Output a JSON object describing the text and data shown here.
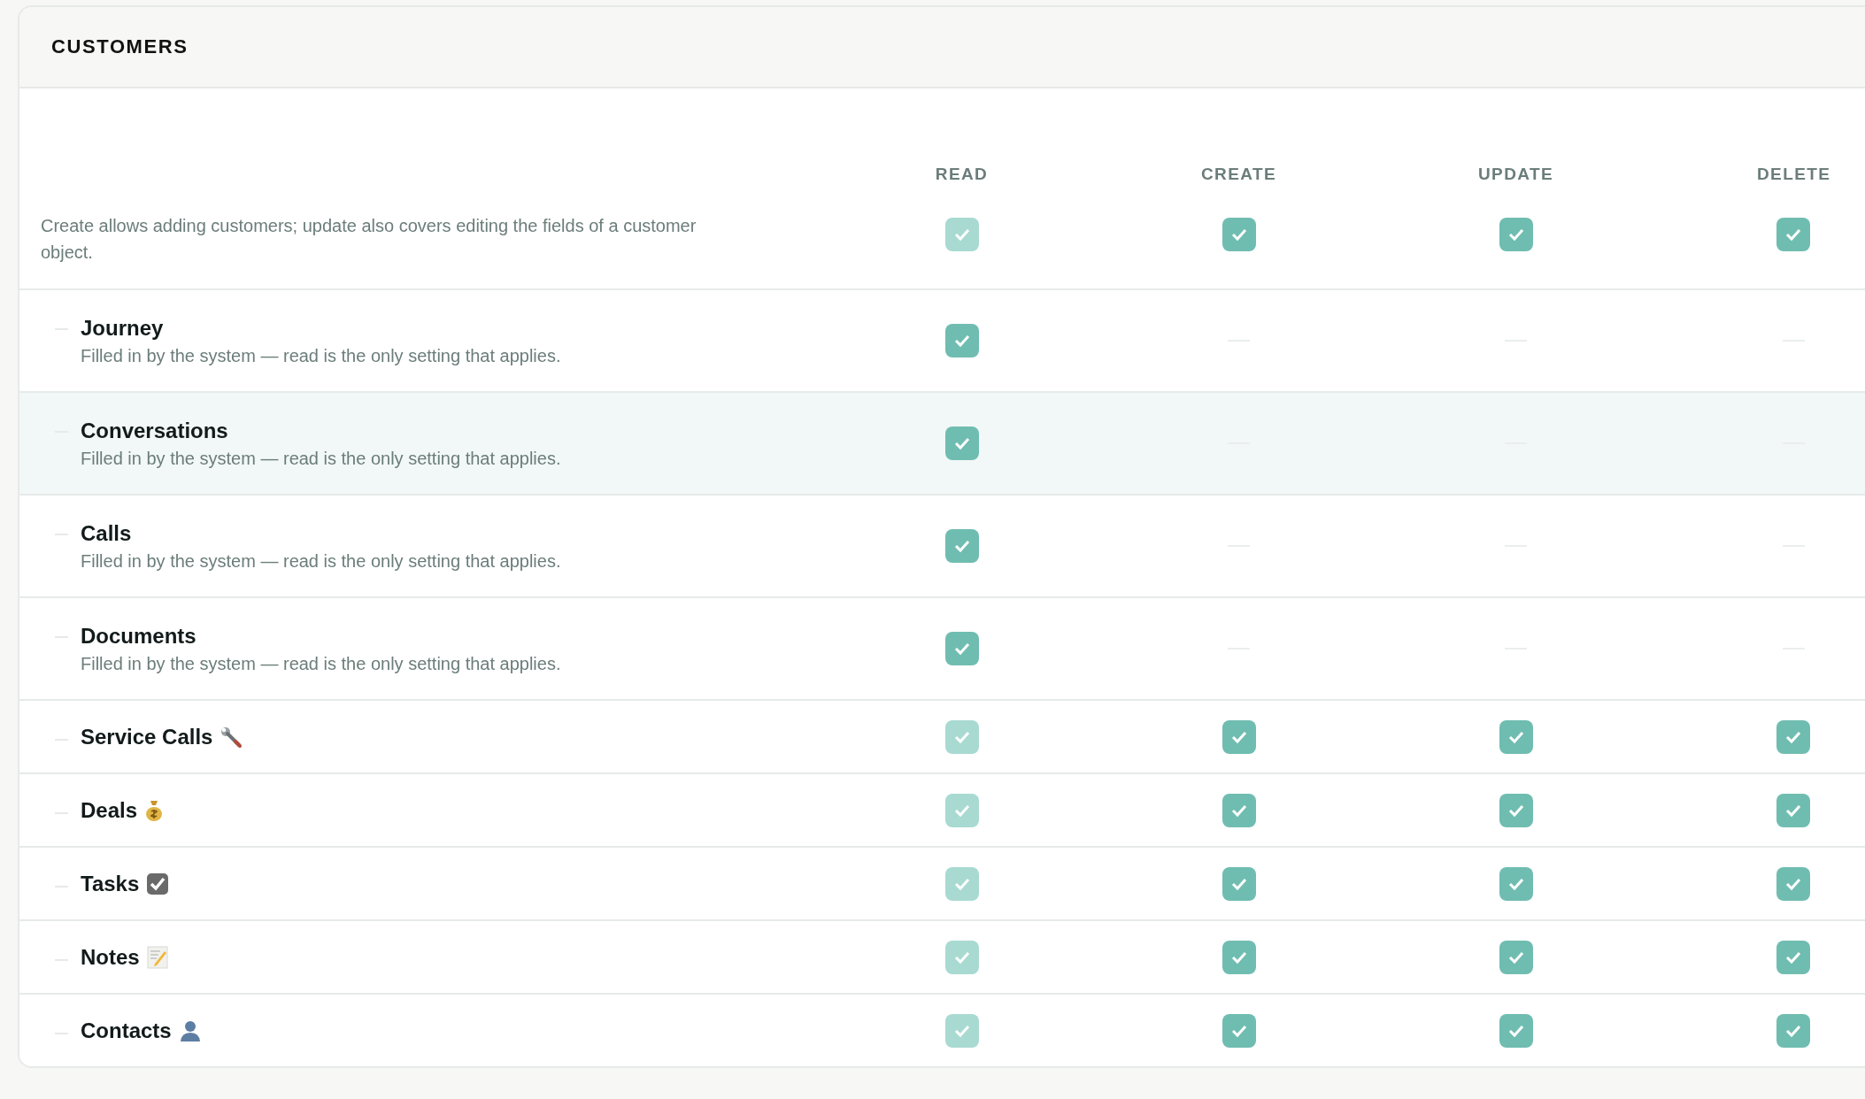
{
  "section": {
    "title": "CUSTOMERS"
  },
  "columns": [
    "READ",
    "CREATE",
    "UPDATE",
    "DELETE"
  ],
  "summary": {
    "description": "Create allows adding customers; update also covers editing the fields of a customer object.",
    "cells": [
      {
        "kind": "checkbox",
        "checked": true,
        "disabled": true
      },
      {
        "kind": "checkbox",
        "checked": true,
        "disabled": false
      },
      {
        "kind": "checkbox",
        "checked": true,
        "disabled": false
      },
      {
        "kind": "checkbox",
        "checked": true,
        "disabled": false
      }
    ]
  },
  "rows": [
    {
      "name": "Journey",
      "note": "Filled in by the system — read is the only setting that applies.",
      "highlighted": false,
      "cells": [
        {
          "kind": "checkbox",
          "checked": true,
          "disabled": false
        },
        {
          "kind": "none"
        },
        {
          "kind": "none"
        },
        {
          "kind": "none"
        }
      ]
    },
    {
      "name": "Conversations",
      "note": "Filled in by the system — read is the only setting that applies.",
      "highlighted": true,
      "cells": [
        {
          "kind": "checkbox",
          "checked": true,
          "disabled": false
        },
        {
          "kind": "none"
        },
        {
          "kind": "none"
        },
        {
          "kind": "none"
        }
      ]
    },
    {
      "name": "Calls",
      "note": "Filled in by the system — read is the only setting that applies.",
      "highlighted": false,
      "cells": [
        {
          "kind": "checkbox",
          "checked": true,
          "disabled": false
        },
        {
          "kind": "none"
        },
        {
          "kind": "none"
        },
        {
          "kind": "none"
        }
      ]
    },
    {
      "name": "Documents",
      "note": "Filled in by the system — read is the only setting that applies.",
      "highlighted": false,
      "cells": [
        {
          "kind": "checkbox",
          "checked": true,
          "disabled": false
        },
        {
          "kind": "none"
        },
        {
          "kind": "none"
        },
        {
          "kind": "none"
        }
      ]
    },
    {
      "name": "Service Calls",
      "highlighted": false,
      "cells": [
        {
          "kind": "checkbox",
          "checked": true,
          "disabled": true
        },
        {
          "kind": "checkbox",
          "checked": true,
          "disabled": false
        },
        {
          "kind": "checkbox",
          "checked": true,
          "disabled": false
        },
        {
          "kind": "checkbox",
          "checked": true,
          "disabled": false
        }
      ]
    },
    {
      "name": "Deals",
      "highlighted": false,
      "cells": [
        {
          "kind": "checkbox",
          "checked": true,
          "disabled": true
        },
        {
          "kind": "checkbox",
          "checked": true,
          "disabled": false
        },
        {
          "kind": "checkbox",
          "checked": true,
          "disabled": false
        },
        {
          "kind": "checkbox",
          "checked": true,
          "disabled": false
        }
      ]
    },
    {
      "name": "Tasks",
      "highlighted": false,
      "cells": [
        {
          "kind": "checkbox",
          "checked": true,
          "disabled": true
        },
        {
          "kind": "checkbox",
          "checked": true,
          "disabled": false
        },
        {
          "kind": "checkbox",
          "checked": true,
          "disabled": false
        },
        {
          "kind": "checkbox",
          "checked": true,
          "disabled": false
        }
      ]
    },
    {
      "name": "Notes",
      "highlighted": false,
      "cells": [
        {
          "kind": "checkbox",
          "checked": true,
          "disabled": true
        },
        {
          "kind": "checkbox",
          "checked": true,
          "disabled": false
        },
        {
          "kind": "checkbox",
          "checked": true,
          "disabled": false
        },
        {
          "kind": "checkbox",
          "checked": true,
          "disabled": false
        }
      ]
    },
    {
      "name": "Contacts",
      "highlighted": false,
      "cells": [
        {
          "kind": "checkbox",
          "checked": true,
          "disabled": true
        },
        {
          "kind": "checkbox",
          "checked": true,
          "disabled": false
        },
        {
          "kind": "checkbox",
          "checked": true,
          "disabled": false
        },
        {
          "kind": "checkbox",
          "checked": true,
          "disabled": false
        }
      ]
    }
  ]
}
